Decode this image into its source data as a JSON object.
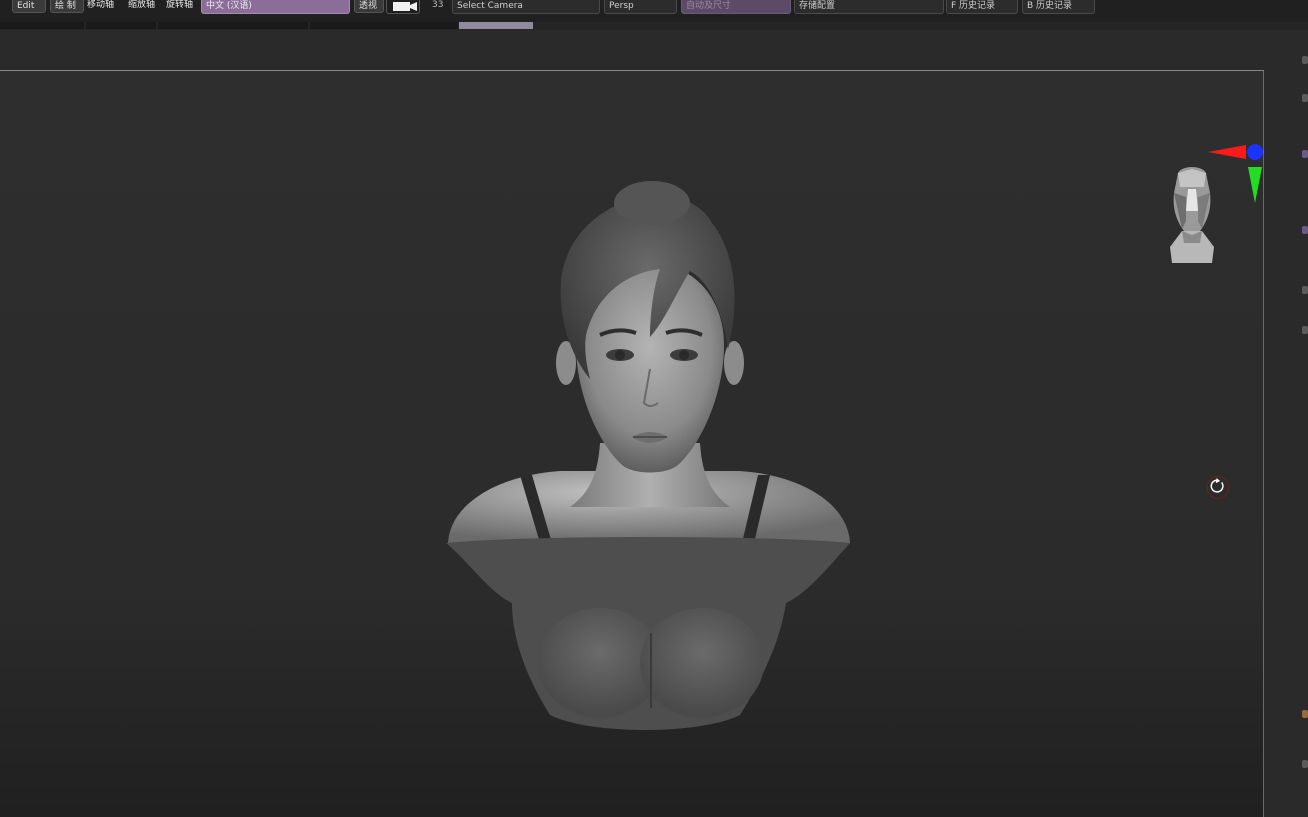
{
  "toolbar": {
    "edit_label": "Edit",
    "draw_label": "绘 制",
    "move_label": "移动轴",
    "scale_label": "缩放轴",
    "rotate_label": "旋转轴",
    "language_value": "中文 (汉语)",
    "perspective_label": "透视",
    "camera_index": "33",
    "camera_select": "Select Camera",
    "persp_field": "Persp",
    "doc_size_field": "自动及尺寸",
    "save_config": "存储配置",
    "f_history": "F 历史记录",
    "b_history": "B 历史记录"
  },
  "colors": {
    "accent": "#8a6e98",
    "axis_x": "#ff1a1a",
    "axis_y": "#22dd22",
    "axis_z": "#1a33ff",
    "viewport_bg": "#2b2b2b"
  },
  "icons": {
    "camera": "camera-icon",
    "rotate": "rotate-icon",
    "gizmo": "axis-gizmo-icon",
    "head_navigator": "head-navigator-icon"
  }
}
